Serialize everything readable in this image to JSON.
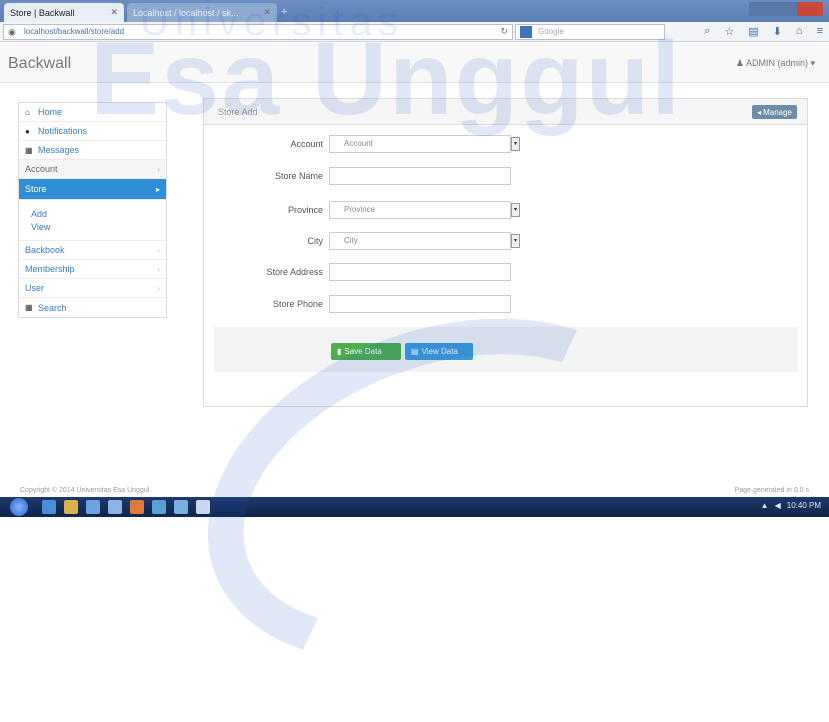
{
  "browser": {
    "tabs": [
      {
        "label": "Store | Backwall"
      },
      {
        "label": "Localhost / localhost / sk..."
      }
    ],
    "url": "localhost/backwall/store/add",
    "search_placeholder": "Google"
  },
  "app": {
    "brand": "Backwall",
    "user": "ADMIN (admin)"
  },
  "watermark": "Esa Unggul",
  "watermark_sub": "Universitas",
  "sidebar": {
    "items": [
      {
        "label": "Home"
      },
      {
        "label": "Notifications"
      },
      {
        "label": "Messages"
      },
      {
        "label": "Account"
      },
      {
        "label": "Store"
      },
      {
        "label": "Add"
      },
      {
        "label": "View"
      },
      {
        "label": "Backbook"
      },
      {
        "label": "Membership"
      },
      {
        "label": "User"
      },
      {
        "label": "Search"
      }
    ]
  },
  "panel": {
    "title": "Store Add",
    "back_label": "Manage"
  },
  "form": {
    "fields": [
      {
        "label": "Account",
        "value": "Account"
      },
      {
        "label": "Store Name",
        "value": ""
      },
      {
        "label": "Province",
        "value": "Province"
      },
      {
        "label": "City",
        "value": "City"
      },
      {
        "label": "Store Address",
        "value": ""
      },
      {
        "label": "Store Phone",
        "value": ""
      }
    ],
    "save_label": "Save Data",
    "view_label": "View Data"
  },
  "footer": {
    "left": "Copyright © 2014 Universitas Esa Unggul",
    "right": "Page generated in 0.0 s"
  },
  "taskbar": {
    "time": "10:40 PM"
  }
}
